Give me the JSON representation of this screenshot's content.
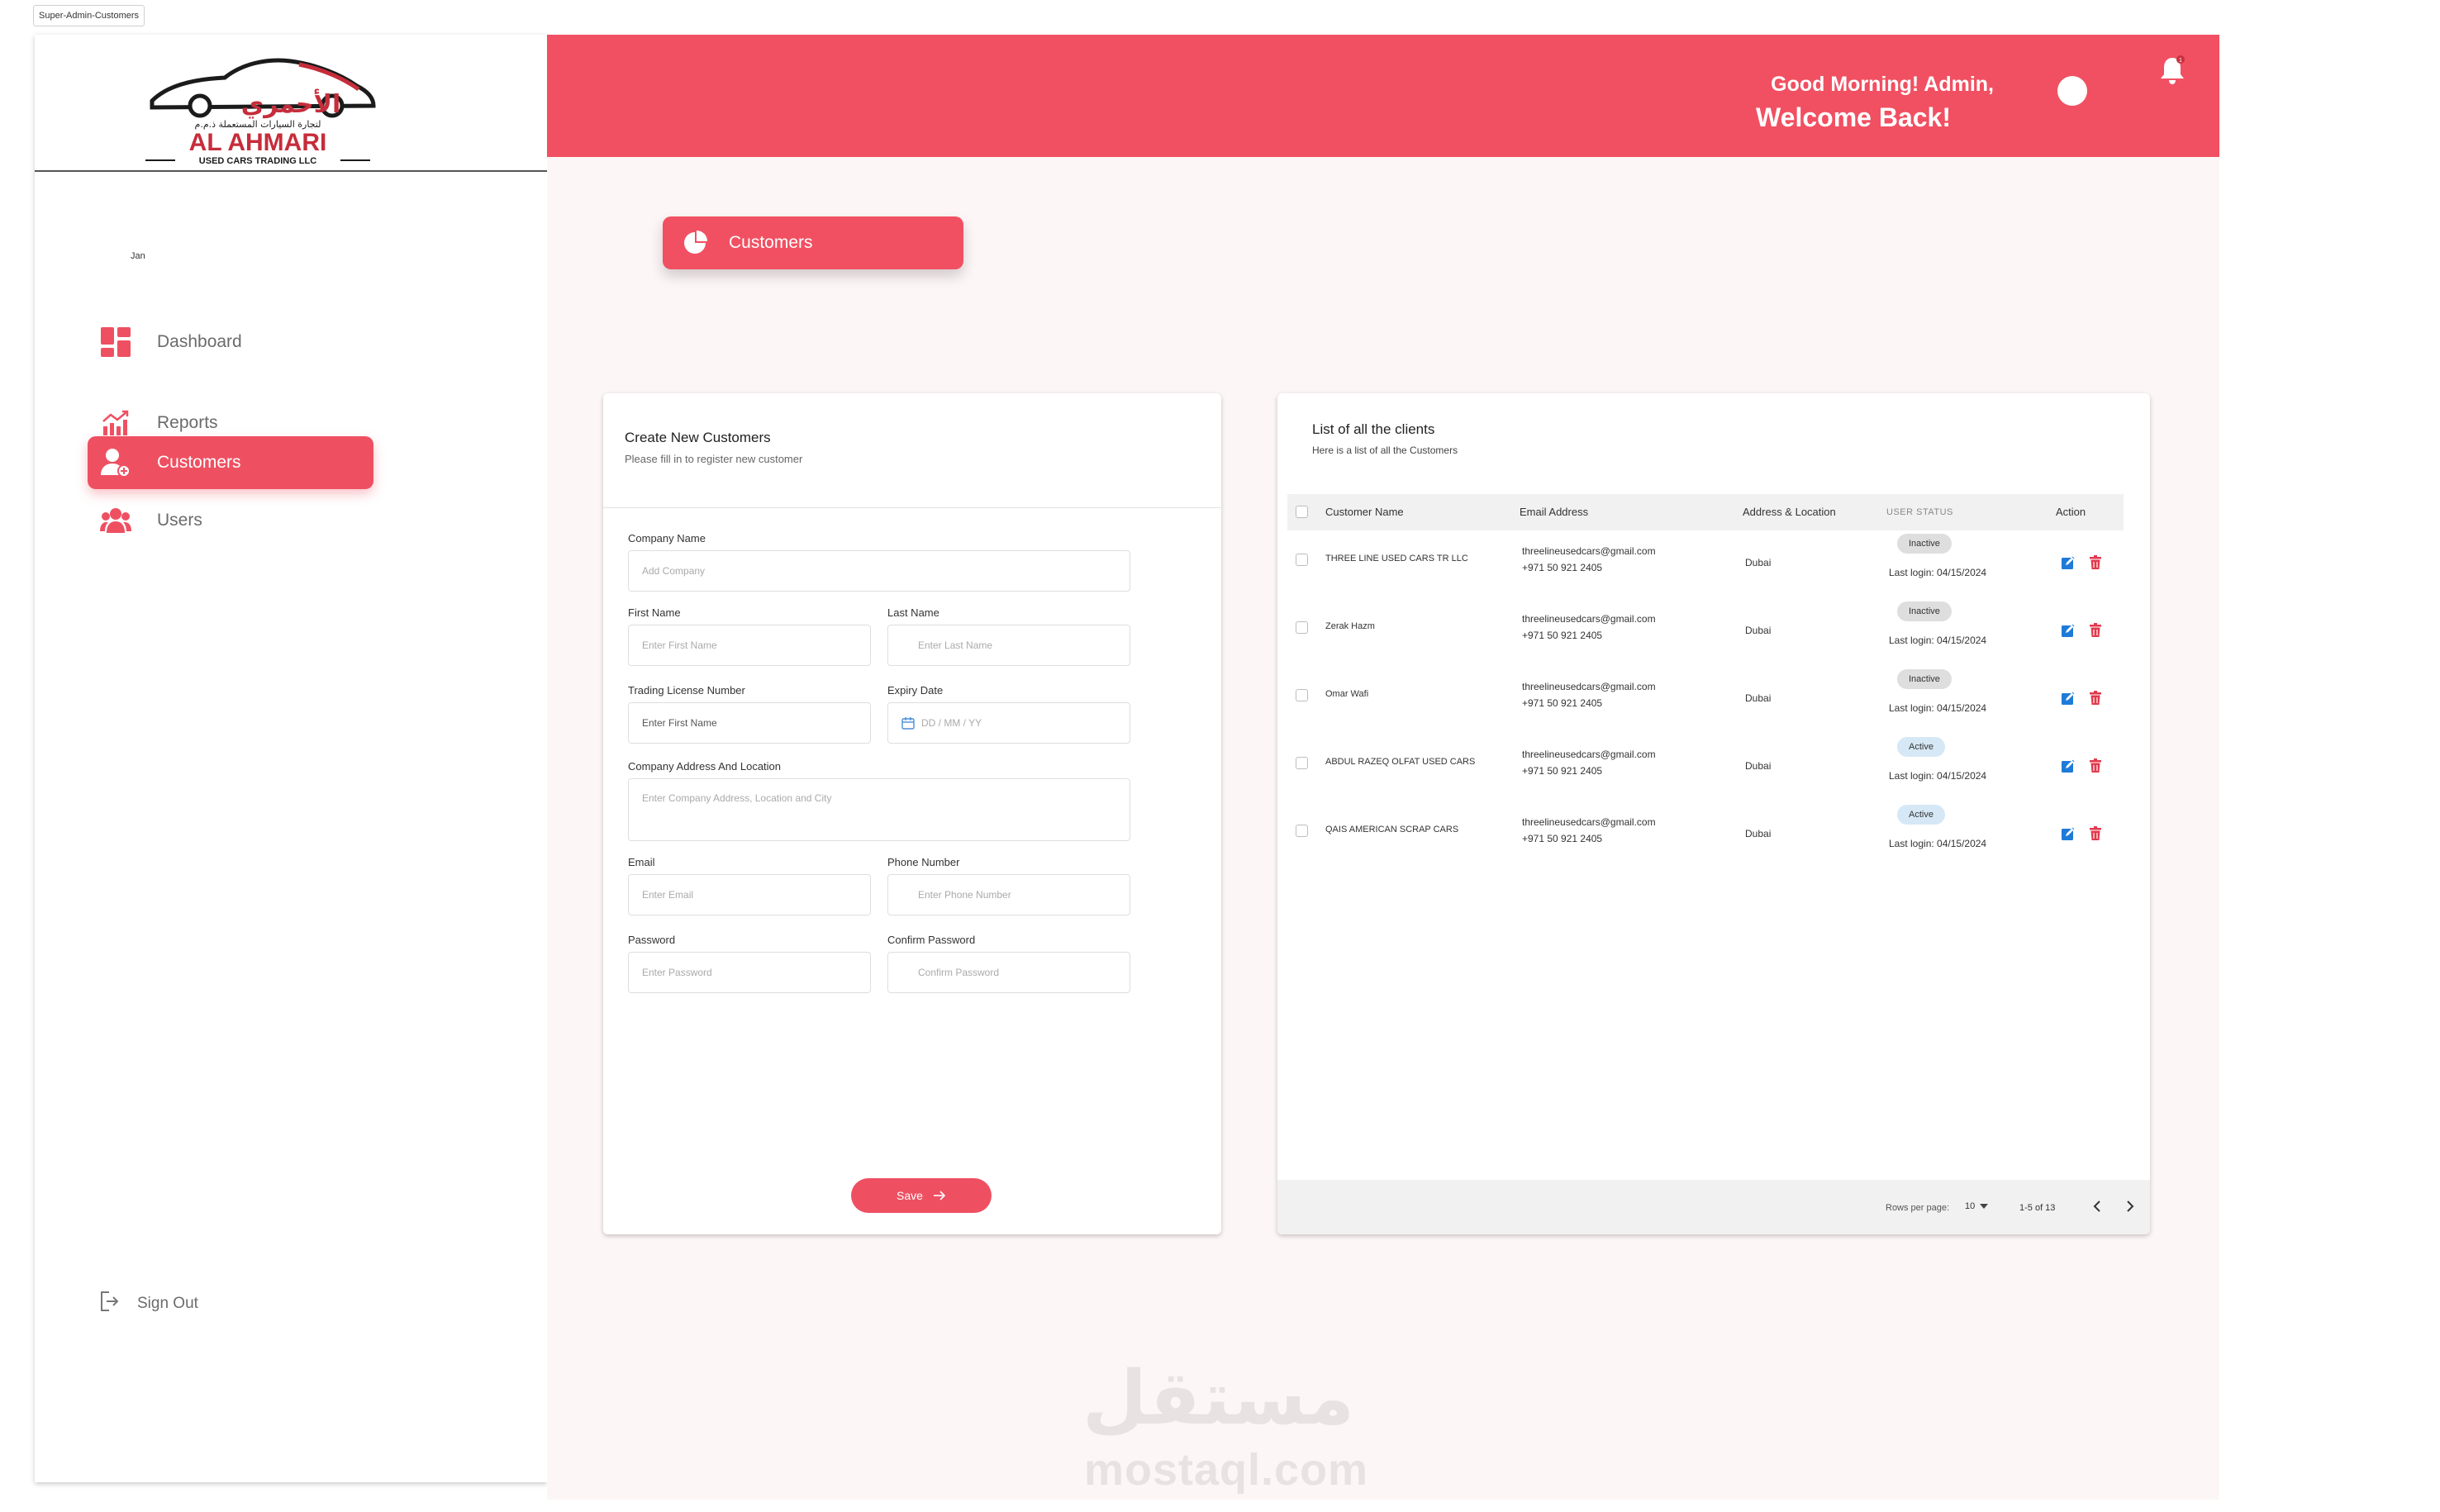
{
  "frame": {
    "label": "Super-Admin-Customers"
  },
  "brand": {
    "name_en": "AL AHMARI",
    "tagline": "USED CARS TRADING LLC",
    "name_ar": "الأحمري",
    "sub_ar": "لتجارة السيارات المستعملة ذ.م.م"
  },
  "sidebar": {
    "jan_label": "Jan",
    "items": [
      {
        "label": "Dashboard",
        "icon": "dashboard-icon",
        "active": false
      },
      {
        "label": "Reports",
        "icon": "reports-chart-icon",
        "active": false
      },
      {
        "label": "Customers",
        "icon": "customer-add-icon",
        "active": true
      },
      {
        "label": "Users",
        "icon": "users-icon",
        "active": false
      }
    ],
    "signout_label": "Sign Out"
  },
  "header": {
    "greeting": "Good Morning!  Admin,",
    "welcome": "Welcome Back!",
    "notification_count": "1"
  },
  "page_pill": {
    "label": "Customers"
  },
  "form": {
    "title": "Create New Customers",
    "subtitle": "Please fill in to register new customer",
    "company_label": "Company  Name",
    "company_placeholder": "Add Company",
    "first_name_label": "First Name",
    "first_name_placeholder": "Enter First  Name",
    "last_name_label": "Last Name",
    "last_name_placeholder": "Enter Last Name",
    "license_label": "Trading License Number",
    "license_placeholder": "Enter First  Name",
    "expiry_label": "Expiry Date",
    "expiry_placeholder": "DD / MM / YY",
    "address_label": "Company Address And Location",
    "address_placeholder": "Enter Company Address, Location and City",
    "email_label": "Email",
    "email_placeholder": "Enter Email",
    "phone_label": "Phone Number",
    "phone_placeholder": "Enter Phone Number",
    "password_label": "Password",
    "password_placeholder": "Enter  Password",
    "confirm_label": "Confirm Password",
    "confirm_placeholder": "Confirm Password",
    "save_label": "Save"
  },
  "list": {
    "title": "List of all the clients",
    "subtitle": "Here is a list of all the Customers",
    "columns": [
      "Customer Name",
      "Email Address",
      "Address & Location",
      "USER STATUS",
      "Action"
    ],
    "rows": [
      {
        "name": "THREE LINE USED CARS TR LLC",
        "email": "threelineusedcars@gmail.com",
        "phone": "+971 50 921 2405",
        "address": "Dubai",
        "status": "Inactive",
        "last_login": "Last login: 04/15/2024"
      },
      {
        "name": "Zerak Hazm",
        "email": "threelineusedcars@gmail.com",
        "phone": "+971 50 921 2405",
        "address": "Dubai",
        "status": "Inactive",
        "last_login": "Last login: 04/15/2024"
      },
      {
        "name": "Omar Wafi",
        "email": "threelineusedcars@gmail.com",
        "phone": "+971 50 921 2405",
        "address": "Dubai",
        "status": "Inactive",
        "last_login": "Last login: 04/15/2024"
      },
      {
        "name": "ABDUL RAZEQ OLFAT USED CARS",
        "email": "threelineusedcars@gmail.com",
        "phone": "+971 50 921 2405",
        "address": "Dubai",
        "status": "Active",
        "last_login": "Last login: 04/15/2024"
      },
      {
        "name": "QAIS AMERICAN SCRAP CARS",
        "email": "threelineusedcars@gmail.com",
        "phone": "+971 50 921 2405",
        "address": "Dubai",
        "status": "Active",
        "last_login": "Last login: 04/15/2024"
      }
    ],
    "footer": {
      "rows_per_page_label": "Rows per page:",
      "rows_per_page_value": "10",
      "range": "1-5 of 13"
    }
  },
  "watermark": {
    "ar": "مستقل",
    "en": "mostaql.com"
  },
  "colors": {
    "accent": "#f15062",
    "sidebar_bg": "#ffffff",
    "content_bg": "#fdf6f6",
    "inactive_badge": "#dedede",
    "active_badge": "#d6e8f5",
    "edit_blue": "#1e7ad8",
    "delete_red": "#e2394c"
  }
}
